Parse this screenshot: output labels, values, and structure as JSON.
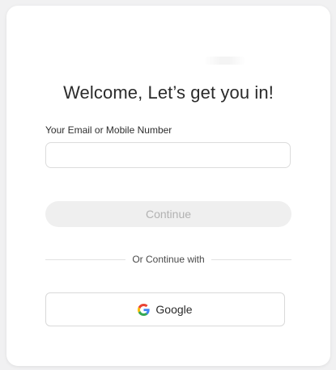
{
  "login": {
    "title": "Welcome, Let’s get you in!",
    "email_label": "Your Email or Mobile Number",
    "email_value": "",
    "email_placeholder": "",
    "continue_label": "Continue",
    "divider_text": "Or Continue with",
    "google_label": "Google",
    "google_icon": "google-icon"
  },
  "colors": {
    "page_background": "#f1f1f2",
    "card_background": "#ffffff",
    "continue_button_bg": "#efefef",
    "continue_button_text": "#b2b2b2",
    "title_text": "#2b2b2b"
  }
}
